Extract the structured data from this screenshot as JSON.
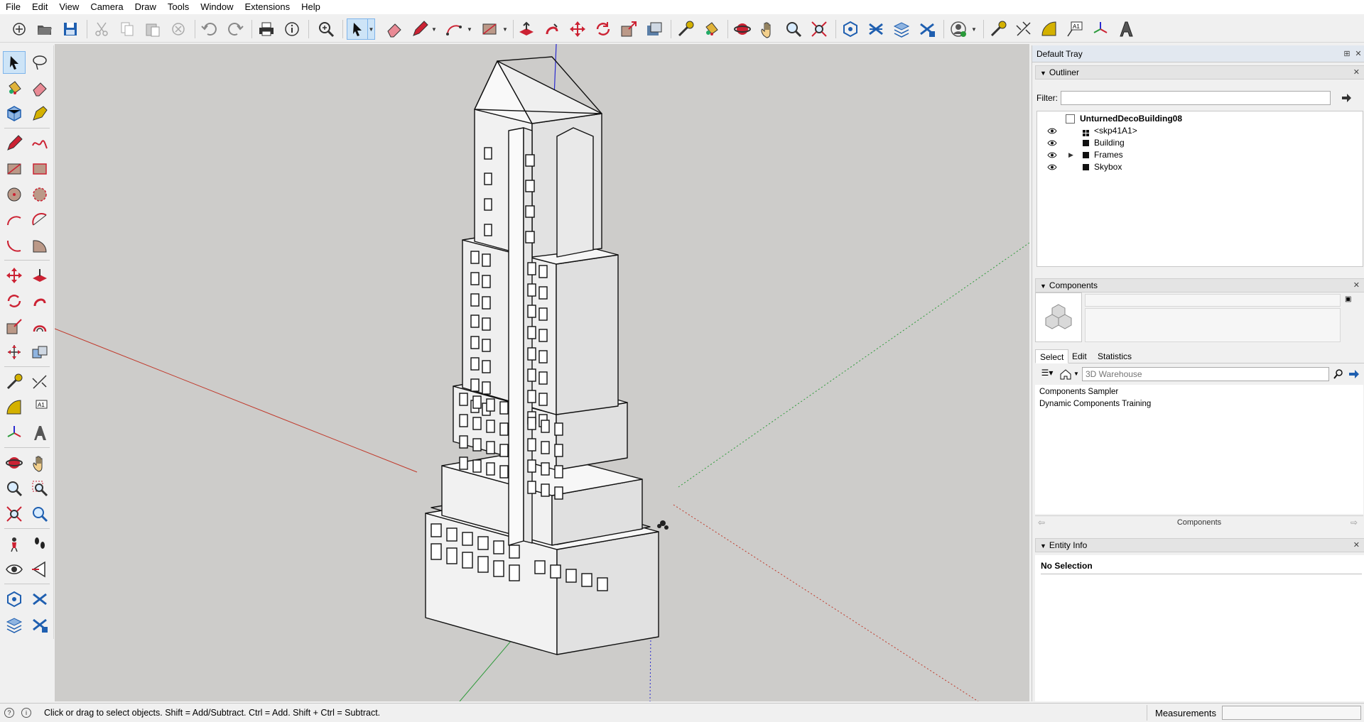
{
  "menu": [
    "File",
    "Edit",
    "View",
    "Camera",
    "Draw",
    "Tools",
    "Window",
    "Extensions",
    "Help"
  ],
  "tray": {
    "title": "Default Tray",
    "outliner": {
      "title": "Outliner",
      "filter_label": "Filter:",
      "filter_value": "",
      "root": "UnturnedDecoBuilding08",
      "items": [
        {
          "label": "<skp41A1>"
        },
        {
          "label": "Building"
        },
        {
          "label": "Frames"
        },
        {
          "label": "Skybox"
        }
      ]
    },
    "components": {
      "title": "Components",
      "tabs": [
        "Select",
        "Edit",
        "Statistics"
      ],
      "active_tab": "Select",
      "search_placeholder": "3D Warehouse",
      "list": [
        "Components Sampler",
        "Dynamic Components Training"
      ],
      "nav_title": "Components"
    },
    "entity_info": {
      "title": "Entity Info",
      "selection": "No Selection"
    }
  },
  "status": {
    "hint": "Click or drag to select objects. Shift = Add/Subtract. Ctrl = Add. Shift + Ctrl = Subtract.",
    "measurements_label": "Measurements",
    "measurements_value": ""
  },
  "colors": {
    "viewport_bg": "#cdccca",
    "axis_red": "#c0392b",
    "axis_green": "#2e9a3a",
    "axis_blue": "#2a2ad0",
    "selected_tool": "#cde4f7"
  }
}
